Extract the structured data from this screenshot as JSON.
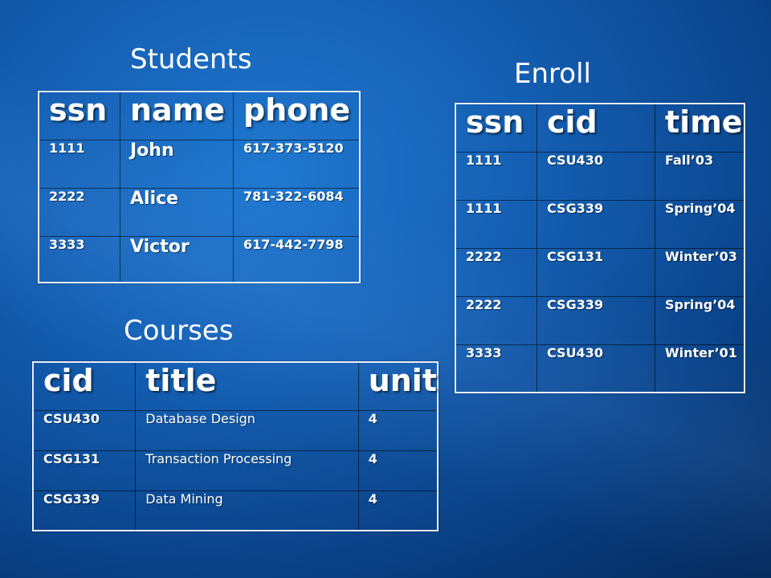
{
  "students": {
    "caption": "Students",
    "headers": [
      "ssn",
      "name",
      "phone"
    ],
    "rows": [
      [
        "1111",
        "John",
        "617-373-5120"
      ],
      [
        "2222",
        "Alice",
        "781-322-6084"
      ],
      [
        "3333",
        "Victor",
        "617-442-7798"
      ]
    ]
  },
  "enroll": {
    "caption": "Enroll",
    "headers": [
      "ssn",
      "cid",
      "time"
    ],
    "rows": [
      [
        "1111",
        "CSU430",
        "Fall’03"
      ],
      [
        "1111",
        "CSG339",
        "Spring’04"
      ],
      [
        "2222",
        "CSG131",
        "Winter’03"
      ],
      [
        "2222",
        "CSG339",
        "Spring’04"
      ],
      [
        "3333",
        "CSU430",
        "Winter’01"
      ]
    ]
  },
  "courses": {
    "caption": "Courses",
    "headers": [
      "cid",
      "title",
      "unit"
    ],
    "rows": [
      [
        "CSU430",
        "Database Design",
        "4"
      ],
      [
        "CSG131",
        "Transaction Processing",
        "4"
      ],
      [
        "CSG339",
        "Data Mining",
        "4"
      ]
    ]
  }
}
